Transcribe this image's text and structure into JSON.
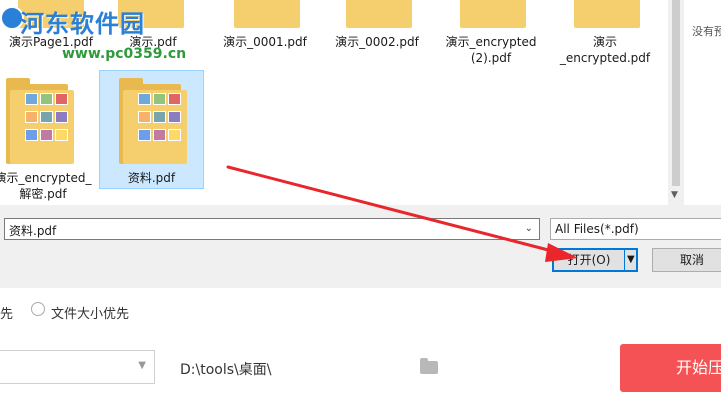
{
  "watermark": {
    "site_name": "河东软件园",
    "url": "www.pc0359.cn"
  },
  "dialog": {
    "files_row1": [
      {
        "name": "演示Page1.pdf"
      },
      {
        "name": "演示.pdf"
      },
      {
        "name": "演示_0001.pdf"
      },
      {
        "name": "演示_0002.pdf"
      },
      {
        "name": "演示_encrypted\n(2).pdf"
      },
      {
        "name": "演示\n_encrypted.pdf"
      }
    ],
    "files_row2": [
      {
        "name": "演示_encrypted_\n解密.pdf"
      },
      {
        "name": "资料.pdf",
        "selected": true
      }
    ],
    "preview_text": "没有预",
    "filename_value": "资料.pdf",
    "filetype_value": "All Files(*.pdf)",
    "open_label": "打开(O)",
    "cancel_label": "取消"
  },
  "app": {
    "option_left": "先",
    "option_size_label": "文件大小优先",
    "output_path": "D:\\tools\\桌面\\",
    "start_label": "开始压"
  },
  "colors": {
    "accent": "#0078d7",
    "selection": "#cce8ff",
    "start_button": "#f45255",
    "arrow": "#e8262b"
  }
}
